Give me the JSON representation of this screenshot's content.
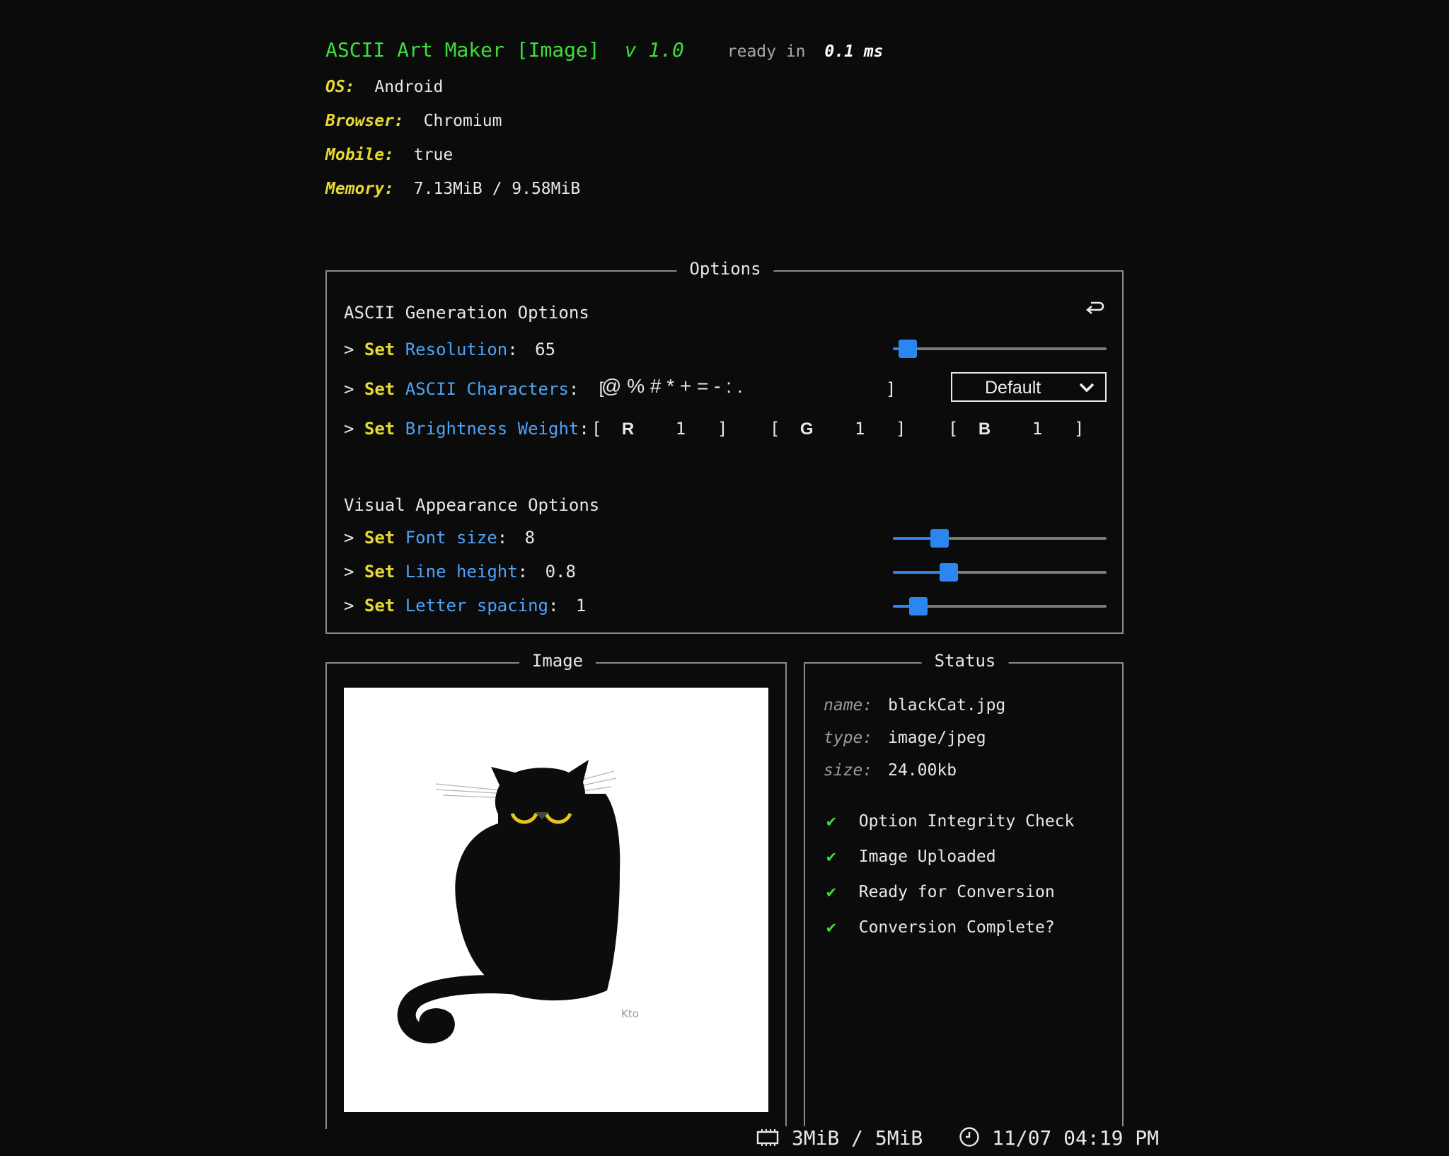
{
  "header": {
    "title": "ASCII Art Maker [Image]",
    "version": "v 1.0",
    "ready_label": "ready in",
    "ready_value": "0.1 ms",
    "os_label": "OS:",
    "os_value": "Android",
    "browser_label": "Browser:",
    "browser_value": "Chromium",
    "mobile_label": "Mobile:",
    "mobile_value": "true",
    "memory_label": "Memory:",
    "memory_value": "7.13MiB / 9.58MiB"
  },
  "options": {
    "legend": "Options",
    "ascii_section": "ASCII Generation Options",
    "reset_icon": "reset-icon",
    "prompt": ">",
    "set_kw": "Set",
    "resolution": {
      "label": "Resolution",
      "value": "65",
      "level": 0.07
    },
    "characters": {
      "label": "ASCII Characters",
      "value": "@ % # * + = - : .",
      "preset": "Default"
    },
    "brightness": {
      "label": "Brightness Weight",
      "channels": [
        {
          "name": "R",
          "value": "1"
        },
        {
          "name": "G",
          "value": "1"
        },
        {
          "name": "B",
          "value": "1"
        }
      ]
    },
    "visual_section": "Visual Appearance Options",
    "font_size": {
      "label": "Font size",
      "value": "8",
      "level": 0.22
    },
    "line_height": {
      "label": "Line height",
      "value": "0.8",
      "level": 0.26
    },
    "letter_spacing": {
      "label": "Letter spacing",
      "value": "1",
      "level": 0.12
    }
  },
  "image_panel": {
    "legend": "Image",
    "signature": "Kto"
  },
  "status_panel": {
    "legend": "Status",
    "name_label": "name:",
    "name_value": "blackCat.jpg",
    "type_label": "type:",
    "type_value": "image/jpeg",
    "size_label": "size:",
    "size_value": "24.00kb",
    "checks": [
      "Option Integrity Check",
      "Image Uploaded",
      "Ready for Conversion",
      "Conversion Complete?"
    ],
    "check_mark": "✔"
  },
  "footer": {
    "memory_icon": "memory-chip-icon",
    "memory": "3MiB / 5MiB",
    "clock_icon": "clock-icon",
    "datetime": "11/07 04:19 PM"
  },
  "colors": {
    "background": "#0b0b0b",
    "title_green": "#3ddc3d",
    "label_yellow": "#e8d832",
    "link_blue": "#4fa3f7",
    "slider_blue": "#2b86f0"
  }
}
